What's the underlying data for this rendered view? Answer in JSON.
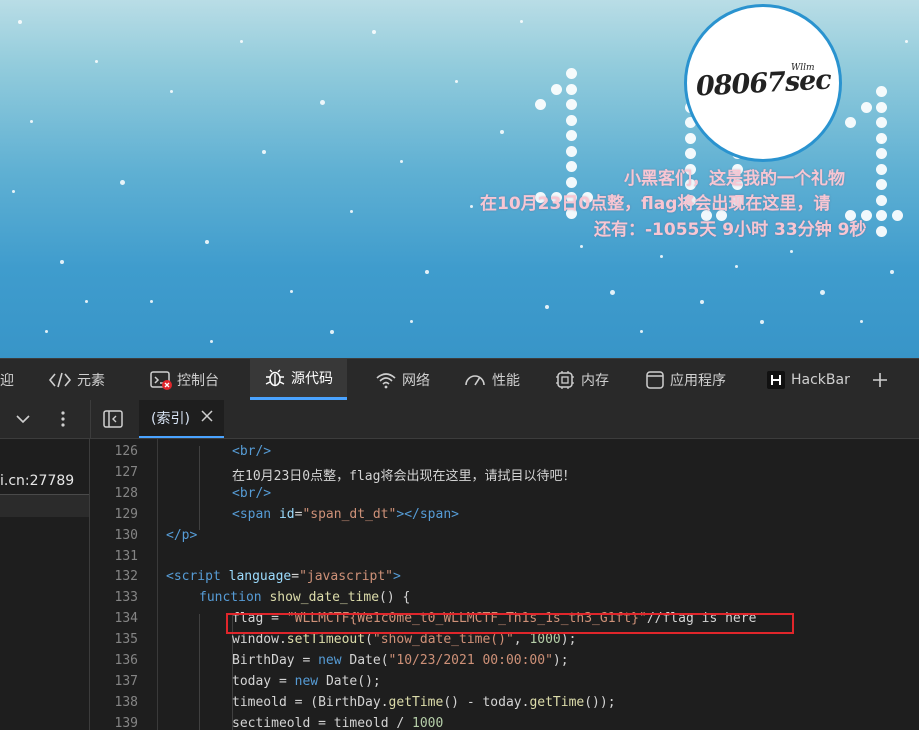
{
  "page": {
    "logo_text": "08067sec",
    "logo_small": "Wllm",
    "line1": "小黑客们，这是我的一个礼物",
    "line2": "在10月23日0点整，flag将会出现在这里，请",
    "line3": "还有：-1055天 9小时 33分钟 9秒"
  },
  "devtools": {
    "tabs": [
      {
        "label": "迎",
        "icon": "welcome-icon"
      },
      {
        "label": "元素",
        "icon": "elements-icon"
      },
      {
        "label": "控制台",
        "icon": "console-icon"
      },
      {
        "label": "源代码",
        "icon": "bug-icon"
      },
      {
        "label": "网络",
        "icon": "wifi-icon"
      },
      {
        "label": "性能",
        "icon": "gauge-icon"
      },
      {
        "label": "内存",
        "icon": "chip-icon"
      },
      {
        "label": "应用程序",
        "icon": "application-icon"
      },
      {
        "label": "HackBar",
        "icon": "hackbar-icon"
      },
      {
        "label": "+",
        "icon": "plus-icon"
      }
    ],
    "file_tab": "(索引)",
    "host": "i.cn:27789"
  },
  "code": {
    "lines": [
      {
        "n": "126",
        "indent": 2,
        "parts": [
          [
            "tag",
            "<br/>"
          ]
        ]
      },
      {
        "n": "127",
        "indent": 2,
        "parts": [
          [
            "plain",
            "在10月23日0点整，flag将会出现在这里，请拭目以待吧！"
          ]
        ]
      },
      {
        "n": "128",
        "indent": 2,
        "parts": [
          [
            "tag",
            "<br/>"
          ]
        ]
      },
      {
        "n": "129",
        "indent": 2,
        "parts": [
          [
            "tag",
            "<span "
          ],
          [
            "attr",
            "id"
          ],
          [
            "plain",
            "="
          ],
          [
            "str",
            "\"span_dt_dt\""
          ],
          [
            "tag",
            "></span>"
          ]
        ]
      },
      {
        "n": "130",
        "indent": 0,
        "parts": [
          [
            "tag",
            "</p>"
          ]
        ]
      },
      {
        "n": "131",
        "indent": 0,
        "parts": []
      },
      {
        "n": "132",
        "indent": 0,
        "parts": [
          [
            "tag",
            "<script "
          ],
          [
            "attr",
            "language"
          ],
          [
            "plain",
            "="
          ],
          [
            "str",
            "\"javascript\""
          ],
          [
            "tag",
            ">"
          ]
        ]
      },
      {
        "n": "133",
        "indent": 1,
        "parts": [
          [
            "kw",
            "function "
          ],
          [
            "fn",
            "show_date_time"
          ],
          [
            "plain",
            "() {"
          ]
        ]
      },
      {
        "n": "134",
        "indent": 2,
        "parts": [
          [
            "plain",
            "flag = "
          ],
          [
            "str",
            "\"WLLMCTF{We1c0me_t0_WLLMCTF_Th1s_1s_th3_G1ft}\""
          ],
          [
            "plain",
            "//flag is here"
          ]
        ]
      },
      {
        "n": "135",
        "indent": 2,
        "parts": [
          [
            "plain",
            "window."
          ],
          [
            "fn",
            "setTimeout"
          ],
          [
            "plain",
            "("
          ],
          [
            "str",
            "\"show_date_time()\""
          ],
          [
            "plain",
            ", "
          ],
          [
            "num",
            "1000"
          ],
          [
            "plain",
            ");"
          ]
        ]
      },
      {
        "n": "136",
        "indent": 2,
        "parts": [
          [
            "plain",
            "BirthDay = "
          ],
          [
            "kw",
            "new "
          ],
          [
            "plain",
            "Date("
          ],
          [
            "str",
            "\"10/23/2021 00:00:00\""
          ],
          [
            "plain",
            ");"
          ]
        ]
      },
      {
        "n": "137",
        "indent": 2,
        "parts": [
          [
            "plain",
            "today = "
          ],
          [
            "kw",
            "new "
          ],
          [
            "plain",
            "Date();"
          ]
        ]
      },
      {
        "n": "138",
        "indent": 2,
        "parts": [
          [
            "plain",
            "timeold = (BirthDay."
          ],
          [
            "fn",
            "getTime"
          ],
          [
            "plain",
            "() - today."
          ],
          [
            "fn",
            "getTime"
          ],
          [
            "plain",
            "());"
          ]
        ]
      },
      {
        "n": "139",
        "indent": 2,
        "parts": [
          [
            "plain",
            "sectimeold = timeold / "
          ],
          [
            "num",
            "1000"
          ]
        ]
      }
    ]
  }
}
